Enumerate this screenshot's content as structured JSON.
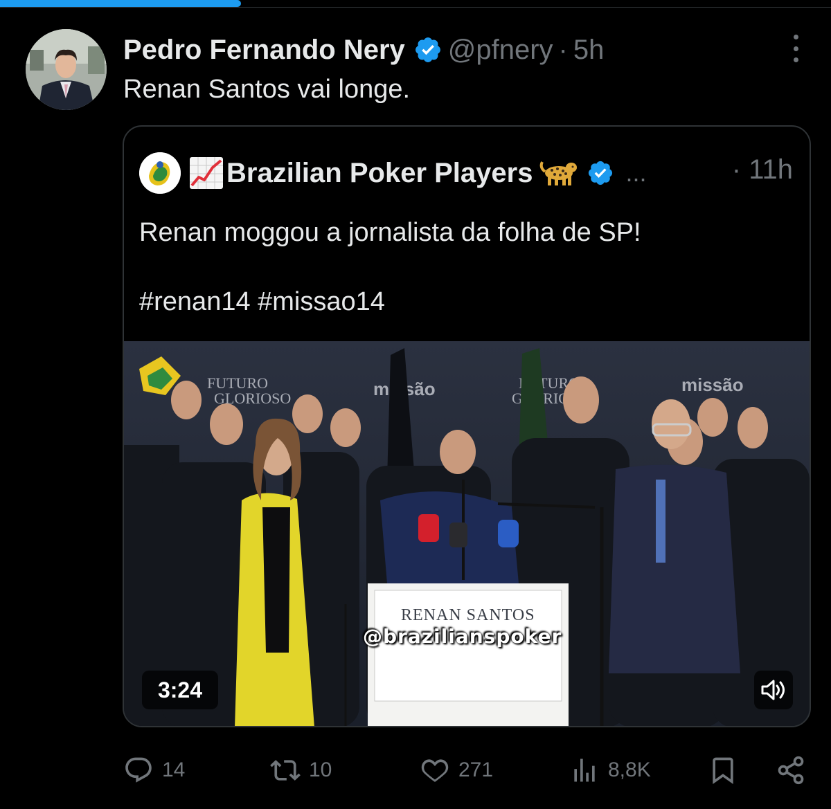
{
  "progress": {
    "fraction": 0.29,
    "color": "#1d9bf0"
  },
  "tweet": {
    "author_name": "Pedro Fernando Nery",
    "handle": "@pfnery",
    "separator": "·",
    "time": "5h",
    "text": "Renan Santos vai longe."
  },
  "quote": {
    "author_name": "Brazilian Poker Players",
    "ellipsis": "...",
    "separator": "·",
    "time": "11h",
    "text_line1": "Renan moggou a jornalista da folha de SP!",
    "text_line2": "#renan14 #missao14",
    "media": {
      "podium_title": "RENAN SANTOS",
      "watermark": "@brazilianspoker",
      "duration": "3:24"
    }
  },
  "actions": {
    "replies": "14",
    "reposts": "10",
    "likes": "271",
    "views": "8,8K"
  },
  "colors": {
    "verified": "#1d9bf0",
    "muted": "#71767b",
    "text": "#e7e9ea",
    "border": "#2f3336"
  },
  "icons": [
    "verified-badge-icon",
    "more-icon",
    "chart-increasing-icon",
    "leopard-icon",
    "reply-icon",
    "repost-icon",
    "like-icon",
    "views-icon",
    "bookmark-icon",
    "share-icon",
    "sound-icon"
  ]
}
